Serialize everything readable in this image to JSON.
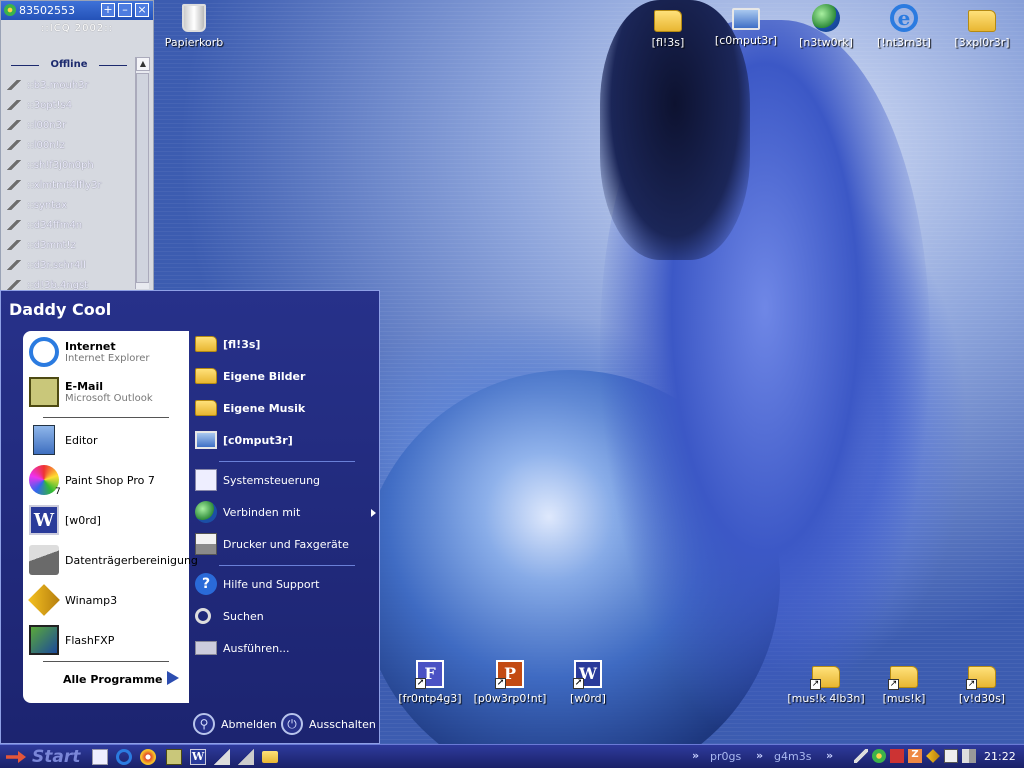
{
  "icq": {
    "title": "83502553",
    "logo": "::ICQ 2002::",
    "group": "Offline",
    "contacts": [
      "::b3.mouh3r",
      "::3opt!s4",
      "::l00n3r",
      "::l00n!z",
      "::sh!f3j0n0ph",
      "::xlmtmt4lfly3r",
      "::syntax",
      "::d34ffm4n",
      "::d3mnt!z",
      "::d3r.schr4ll",
      "::d!3b.4ngst"
    ]
  },
  "desktop_icons": [
    {
      "label": "Papierkorb",
      "icon": "recycle-bin-icon"
    },
    {
      "label": "[fl!3s]",
      "icon": "folder-icon"
    },
    {
      "label": "[c0mput3r]",
      "icon": "computer-icon"
    },
    {
      "label": "[n3tw0rk]",
      "icon": "network-icon"
    },
    {
      "label": "[!nt3rn3t]",
      "icon": "internet-explorer-icon"
    },
    {
      "label": "[3xpl0r3r]",
      "icon": "explorer-icon"
    },
    {
      "label": "[fr0ntp4g3]",
      "icon": "frontpage-icon"
    },
    {
      "label": "[p0w3rp0!nt]",
      "icon": "powerpoint-icon"
    },
    {
      "label": "[w0rd]",
      "icon": "word-icon"
    },
    {
      "label": "[mus!k 4lb3n]",
      "icon": "music-albums-folder-icon"
    },
    {
      "label": "[mus!k]",
      "icon": "music-folder-icon"
    },
    {
      "label": "[v!d30s]",
      "icon": "videos-folder-icon"
    }
  ],
  "start_menu": {
    "user": "Daddy Cool",
    "pinned": [
      {
        "title": "Internet",
        "subtitle": "Internet Explorer"
      },
      {
        "title": "E-Mail",
        "subtitle": "Microsoft Outlook"
      }
    ],
    "recent": [
      "Editor",
      "Paint Shop Pro 7",
      "[w0rd]",
      "Datenträgerbereinigung",
      "Winamp3",
      "FlashFXP"
    ],
    "psp_badge": "7",
    "all_programs": "Alle Programme",
    "right": {
      "places": [
        "[fl!3s]",
        "Eigene Bilder",
        "Eigene Musik",
        "[c0mput3r]"
      ],
      "system": [
        "Systemsteuerung",
        "Verbinden mit",
        "Drucker und Faxgeräte"
      ],
      "tools": [
        "Hilfe und Support",
        "Suchen",
        "Ausführen..."
      ]
    },
    "logoff": "Abmelden",
    "shutdown": "Ausschalten"
  },
  "taskbar": {
    "start": "Start",
    "toolbars": [
      "pr0gs",
      "g4m3s"
    ],
    "chevron": "»",
    "clock": "21:22"
  }
}
